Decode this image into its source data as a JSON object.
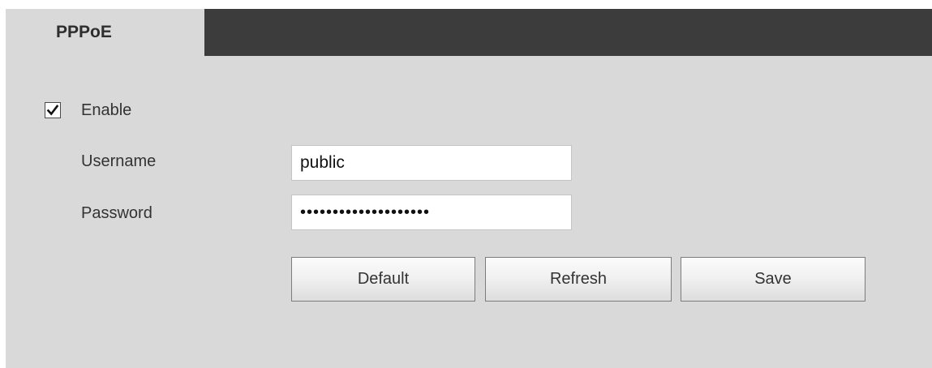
{
  "tabs": [
    {
      "label": "PPPoE",
      "active": true
    }
  ],
  "form": {
    "enable": {
      "label": "Enable",
      "checked": true
    },
    "username": {
      "label": "Username",
      "value": "public"
    },
    "password": {
      "label": "Password",
      "value": "••••••••••••••••••••"
    }
  },
  "buttons": {
    "default_label": "Default",
    "refresh_label": "Refresh",
    "save_label": "Save"
  },
  "colors": {
    "panel_bg": "#d9d9d9",
    "tabbar_bg": "#3c3c3c"
  },
  "icons": {
    "checkbox": "checkmark-icon"
  }
}
